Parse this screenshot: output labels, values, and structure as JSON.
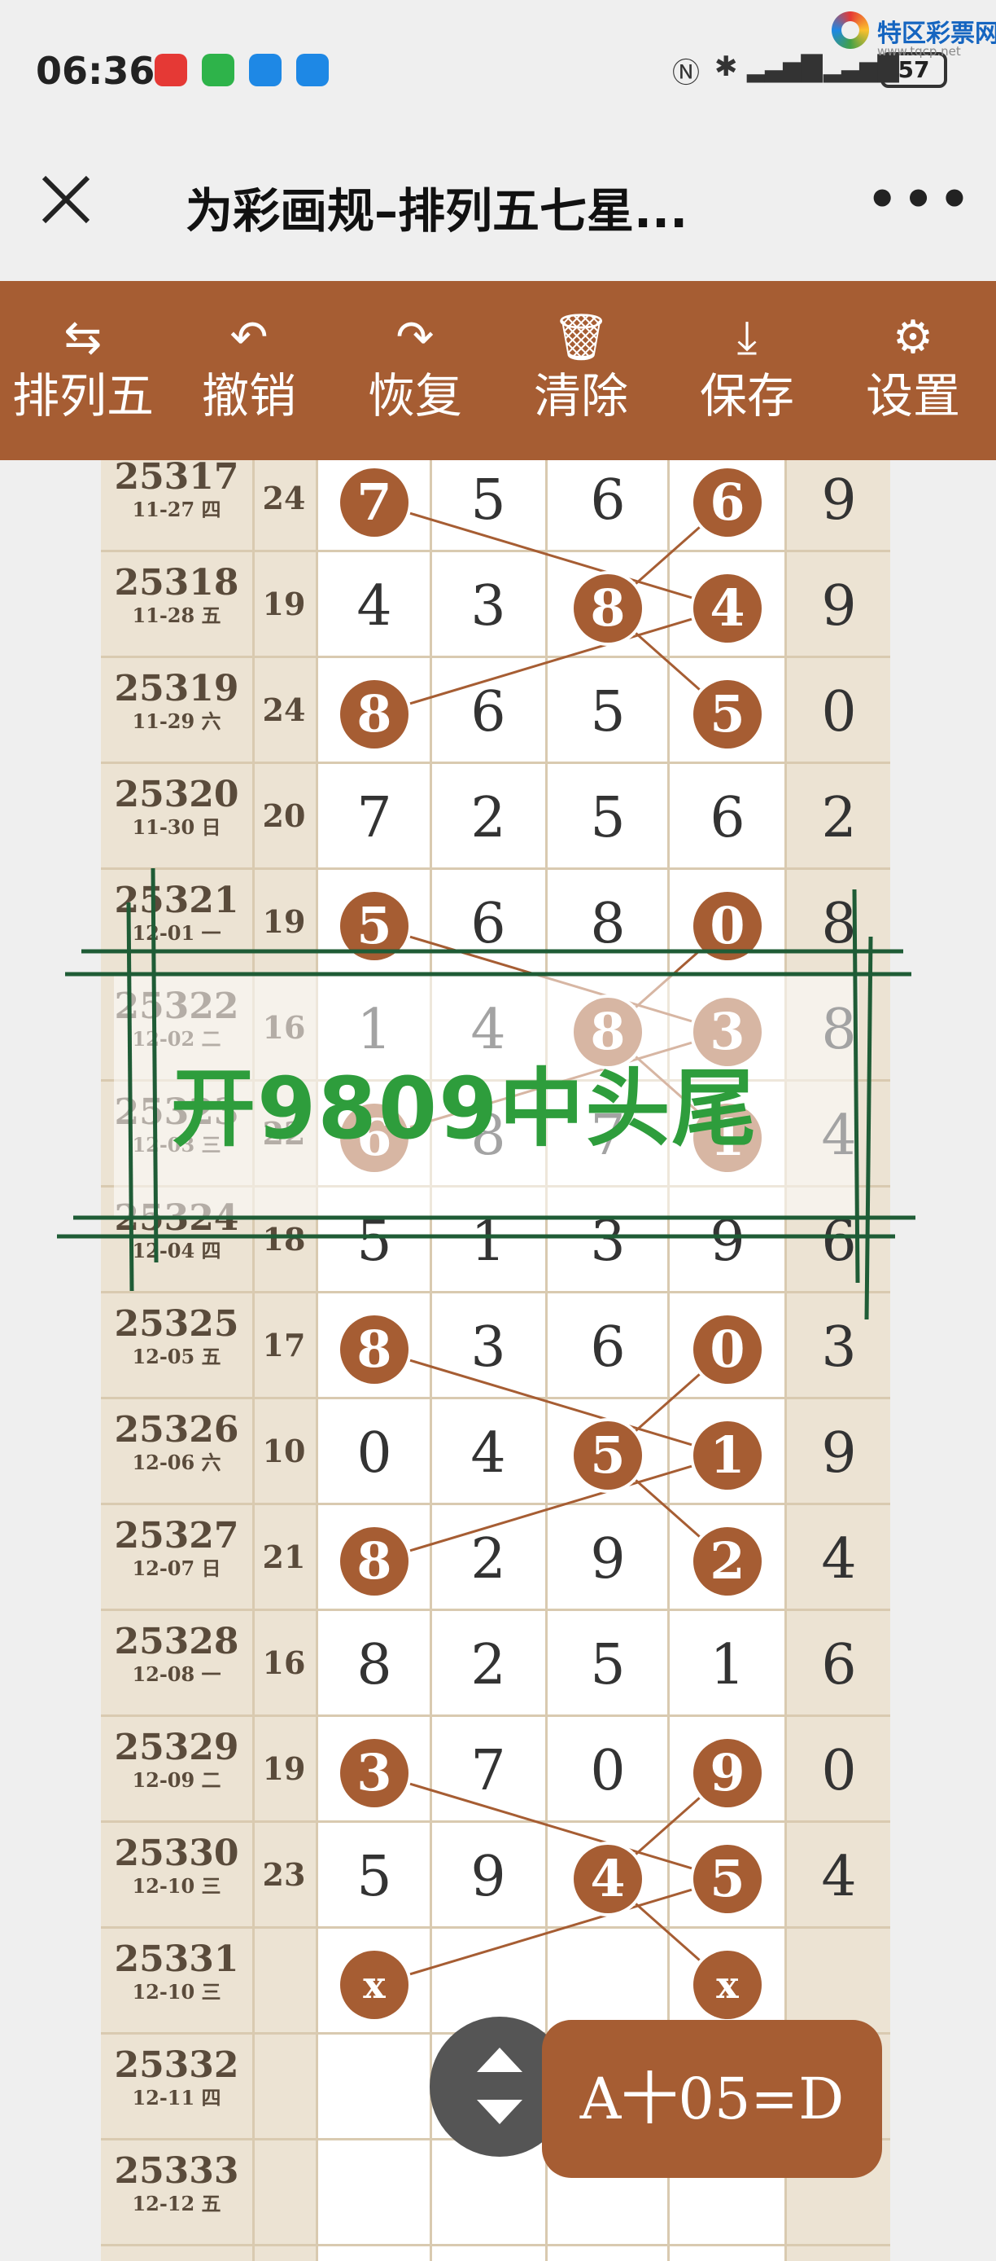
{
  "status_bar": {
    "time": "06:36",
    "battery": "57",
    "app_icons": [
      "notification-icon",
      "wechat-icon",
      "cloud-icon",
      "message-icon"
    ],
    "system_icons": [
      "nfc-icon",
      "bluetooth-icon",
      "signal-icon",
      "signal-icon"
    ]
  },
  "watermark": {
    "name": "特区彩票网",
    "url": "www.tqcp.net"
  },
  "nav": {
    "title": "为彩画规–排列五七星..."
  },
  "toolbar": {
    "items": [
      {
        "icon": "swap-icon",
        "label": "排列五"
      },
      {
        "icon": "undo-icon",
        "label": "撤销"
      },
      {
        "icon": "redo-icon",
        "label": "恢复"
      },
      {
        "icon": "trash-icon",
        "label": "清除"
      },
      {
        "icon": "download-icon",
        "label": "保存"
      },
      {
        "icon": "gear-icon",
        "label": "设置"
      }
    ]
  },
  "accent_color": "#a65d33",
  "rows": [
    {
      "issue": "25317",
      "date": "11-27 四",
      "sum": "24",
      "digits": [
        "7",
        "5",
        "6",
        "6",
        "9"
      ],
      "marked": [
        0,
        3
      ]
    },
    {
      "issue": "25318",
      "date": "11-28 五",
      "sum": "19",
      "digits": [
        "4",
        "3",
        "8",
        "4",
        "9"
      ],
      "marked": [
        2,
        3
      ]
    },
    {
      "issue": "25319",
      "date": "11-29 六",
      "sum": "24",
      "digits": [
        "8",
        "6",
        "5",
        "5",
        "0"
      ],
      "marked": [
        0,
        3
      ]
    },
    {
      "issue": "25320",
      "date": "11-30 日",
      "sum": "20",
      "digits": [
        "7",
        "2",
        "5",
        "6",
        "2"
      ],
      "marked": []
    },
    {
      "issue": "25321",
      "date": "12-01 一",
      "sum": "19",
      "digits": [
        "5",
        "6",
        "8",
        "0",
        "8"
      ],
      "marked": [
        0,
        3
      ]
    },
    {
      "issue": "25322",
      "date": "12-02 二",
      "sum": "16",
      "digits": [
        "1",
        "4",
        "8",
        "3",
        "8"
      ],
      "marked": [
        2,
        3
      ]
    },
    {
      "issue": "25323",
      "date": "12-03 三",
      "sum": "22",
      "digits": [
        "6",
        "8",
        "7",
        "1",
        "4"
      ],
      "marked": [
        0,
        3
      ]
    },
    {
      "issue": "25324",
      "date": "12-04 四",
      "sum": "18",
      "digits": [
        "5",
        "1",
        "3",
        "9",
        "6"
      ],
      "marked": []
    },
    {
      "issue": "25325",
      "date": "12-05 五",
      "sum": "17",
      "digits": [
        "8",
        "3",
        "6",
        "0",
        "3"
      ],
      "marked": [
        0,
        3
      ]
    },
    {
      "issue": "25326",
      "date": "12-06 六",
      "sum": "10",
      "digits": [
        "0",
        "4",
        "5",
        "1",
        "9"
      ],
      "marked": [
        2,
        3
      ]
    },
    {
      "issue": "25327",
      "date": "12-07 日",
      "sum": "21",
      "digits": [
        "8",
        "2",
        "9",
        "2",
        "4"
      ],
      "marked": [
        0,
        3
      ]
    },
    {
      "issue": "25328",
      "date": "12-08 一",
      "sum": "16",
      "digits": [
        "8",
        "2",
        "5",
        "1",
        "6"
      ],
      "marked": []
    },
    {
      "issue": "25329",
      "date": "12-09 二",
      "sum": "19",
      "digits": [
        "3",
        "7",
        "0",
        "9",
        "0"
      ],
      "marked": [
        0,
        3
      ]
    },
    {
      "issue": "25330",
      "date": "12-10 三",
      "sum": "23",
      "digits": [
        "5",
        "9",
        "4",
        "5",
        "4"
      ],
      "marked": [
        2,
        3
      ]
    },
    {
      "issue": "25331",
      "date": "12-10 三",
      "sum": "",
      "digits": [
        "x",
        "",
        "",
        "x",
        ""
      ],
      "marked": [
        0,
        3
      ]
    },
    {
      "issue": "25332",
      "date": "12-11 四",
      "sum": "",
      "digits": [
        "",
        "",
        "",
        "",
        ""
      ],
      "marked": []
    },
    {
      "issue": "25333",
      "date": "12-12 五",
      "sum": "",
      "digits": [
        "",
        "",
        "",
        "",
        ""
      ],
      "marked": []
    }
  ],
  "overlay": {
    "text": "开9809中头尾"
  },
  "fab": {
    "toggle_icon": "up-down-icon",
    "formula": "A十05=D"
  }
}
